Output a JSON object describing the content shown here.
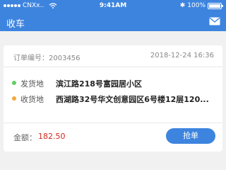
{
  "status_bar": {
    "carrier": "CNXx..",
    "time": "9:41AM",
    "battery": "100%",
    "battery_level": 1.0,
    "icons": [
      "signal-icon",
      "wifi-icon",
      "bluetooth-icon",
      "battery-icon"
    ]
  },
  "header": {
    "title": "收车",
    "mail_icon": "mail-icon"
  },
  "order": {
    "order_no": "订单编号：2003456",
    "datetime": "2018-12-24  16:36",
    "origin_label": "发货地",
    "origin_value": "滨江路218号富园居小区",
    "origin_color": "#5fcf5f",
    "destination_label": "收货地",
    "destination_value": "西湖路32号华文创意园区6号楼12层120...",
    "destination_color": "#f3a83a",
    "amount_label": "金额：",
    "amount_value": "182.50",
    "amount_color": "#d0281e",
    "action_label": "抢单"
  },
  "colors": {
    "accent": "#3d84df",
    "background": "#f1f1f1"
  }
}
